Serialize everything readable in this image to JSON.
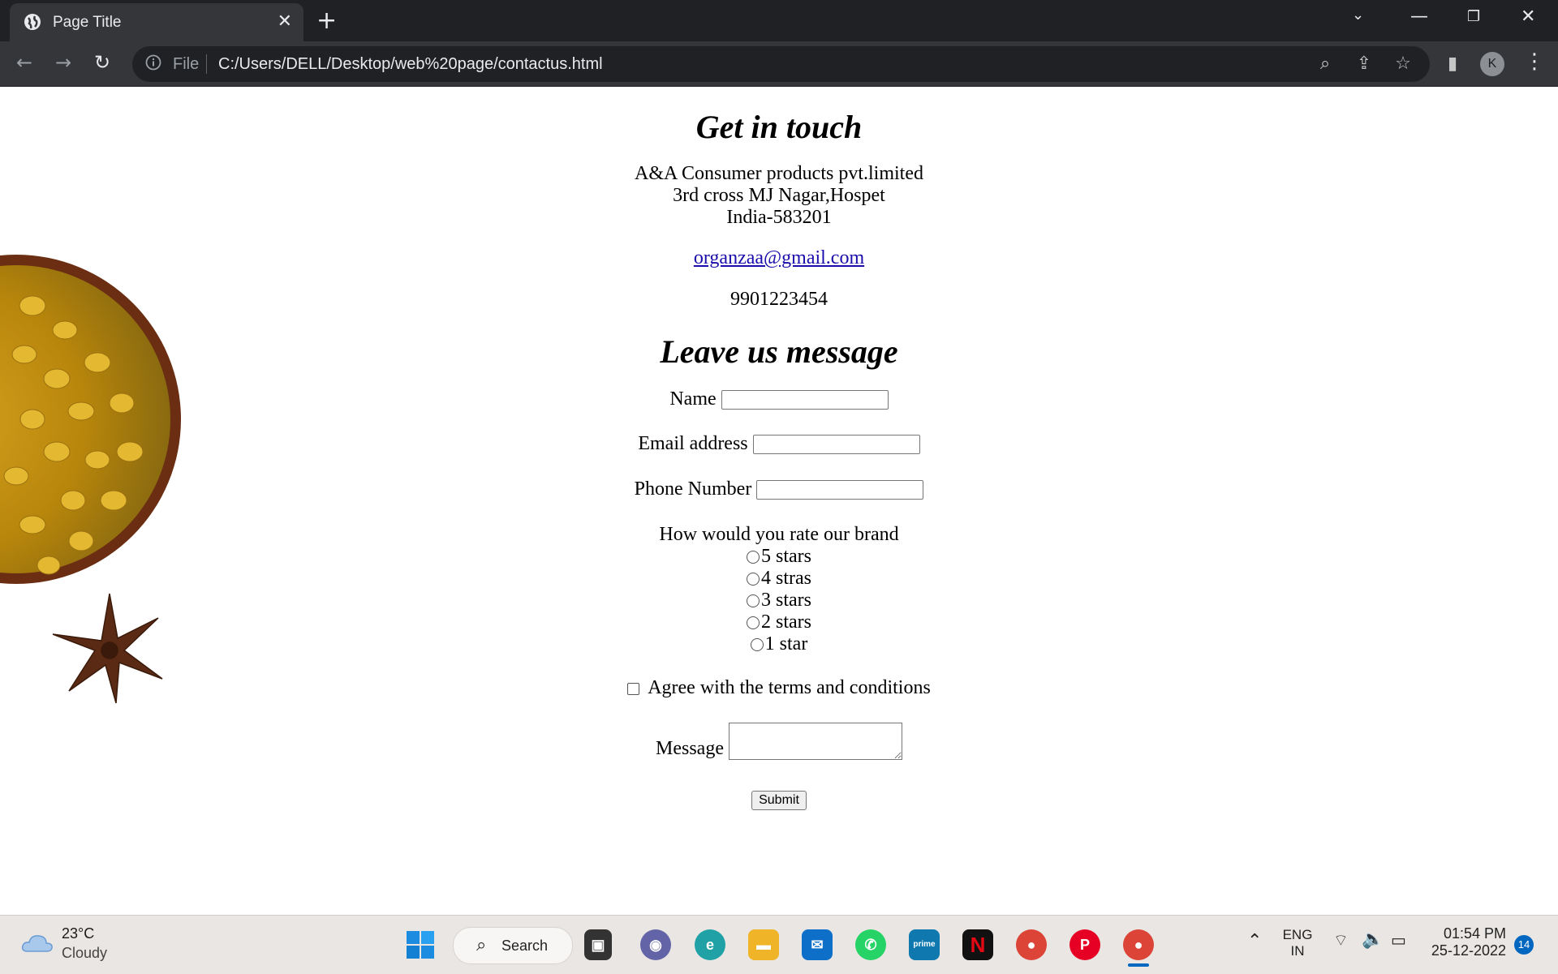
{
  "browser": {
    "tab_title": "Page Title",
    "address_scheme": "File",
    "address_url": "C:/Users/DELL/Desktop/web%20page/contactus.html",
    "profile_initial": "K"
  },
  "page": {
    "heading_contact": "Get in touch",
    "company_name": "A&A Consumer products pvt.limited",
    "address_line": "3rd cross MJ Nagar,Hospet",
    "country_pin": "India-583201",
    "email": "organzaa@gmail.com",
    "phone": "9901223454",
    "heading_form": "Leave us message",
    "form": {
      "name_label": "Name",
      "email_label": "Email address",
      "phone_label": "Phone Number",
      "rating_question": "How would you rate our brand",
      "rating_options": [
        "5 stars",
        "4 stras",
        "3 stars",
        "2 stars",
        "1 star"
      ],
      "terms_label": "Agree with the terms and conditions",
      "message_label": "Message",
      "submit_label": "Submit"
    }
  },
  "taskbar": {
    "weather_temp": "23°C",
    "weather_desc": "Cloudy",
    "search_label": "Search",
    "lang_top": "ENG",
    "lang_bottom": "IN",
    "time": "01:54 PM",
    "date": "25-12-2022",
    "notifications": "14"
  },
  "colors": {
    "tabbar": "#202124",
    "toolbar": "#35363a",
    "link": "#1a0dab",
    "taskbar": "#eae6e3"
  }
}
